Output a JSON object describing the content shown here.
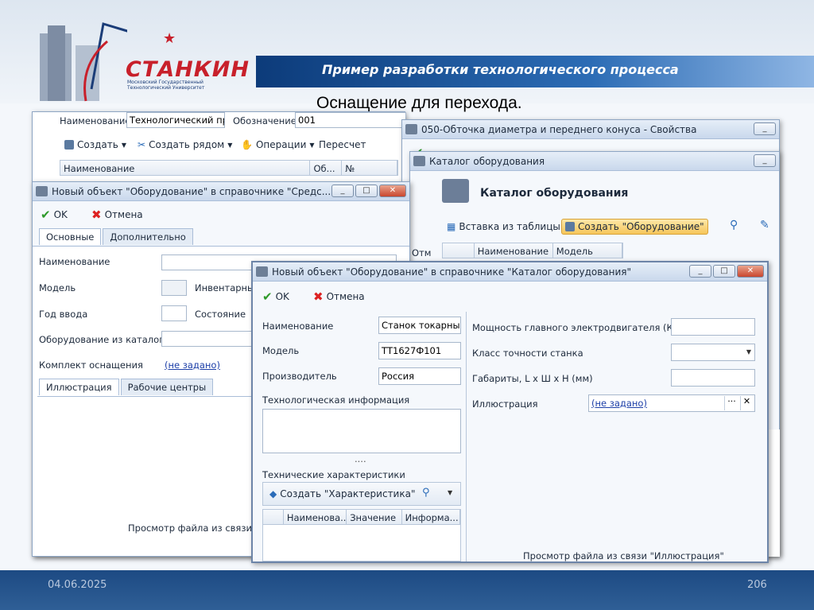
{
  "slide": {
    "title": "Пример разработки технологического процесса",
    "subtitle": "Оснащение для перехода.",
    "date": "04.06.2025",
    "page": "206"
  },
  "logo": {
    "name": "СТАНКИН",
    "subtitle": "Московский Государственный Технологический Университет"
  },
  "colors": {
    "header_bar": "#1b4f93",
    "footer": "#244f86",
    "logo_red": "#c8202b"
  },
  "back_window": {
    "name_label": "Наименование",
    "name_value": "Технологический про",
    "designation_label": "Обозначение",
    "designation_value": "001",
    "toolbar": {
      "create": "Создать",
      "create_near": "Создать рядом",
      "operations": "Операции",
      "recalc": "Пересчет"
    },
    "columns": [
      "Наименование",
      "Об...",
      "№"
    ]
  },
  "props_window": {
    "title": "050-Обточка диаметра и переднего конуса - Свойства",
    "no_label": "№"
  },
  "catalog_window": {
    "title": "Каталог оборудования",
    "heading": "Каталог оборудования",
    "insert_from_table": "Вставка из таблицы",
    "create_btn": "Создать \"Оборудование\"",
    "columns": [
      "Наименование",
      "Модель"
    ],
    "side_labels": [
      "Отм"
    ]
  },
  "left_dialog": {
    "title": "Новый объект \"Оборудование\" в справочнике \"Средс...",
    "ok": "OK",
    "cancel": "Отмена",
    "tabs": [
      "Основные",
      "Дополнительно"
    ],
    "fields": {
      "name": "Наименование",
      "model": "Модель",
      "inventory": "Инвентарный",
      "year": "Год ввода",
      "state": "Состояние",
      "from_catalog": "Оборудование из каталога",
      "kit": "Комплект оснащения",
      "kit_value": "(не задано)"
    },
    "bottom_tabs": [
      "Иллюстрация",
      "Рабочие центры"
    ],
    "preview": "Просмотр файла из связи \"Илл"
  },
  "front_dialog": {
    "title": "Новый объект \"Оборудование\" в справочнике \"Каталог оборудования\"",
    "ok": "OK",
    "cancel": "Отмена",
    "left": {
      "name_label": "Наименование",
      "name_value": "Станок токарный",
      "model_label": "Модель",
      "model_value": "ТТ1627Ф101",
      "maker_label": "Производитель",
      "maker_value": "Россия",
      "techinfo_label": "Технологическая информация",
      "dots": "....",
      "chars_label": "Технические характеристики",
      "create_char": "Создать \"Характеристика\"",
      "columns": [
        "Наименова...",
        "Значение",
        "Информа..."
      ]
    },
    "right": {
      "power_label": "Мощность главного электродвигателя (Квт)",
      "class_label": "Класс точности станка",
      "dims_label": "Габариты, L x Ш x H (мм)",
      "illus_label": "Иллюстрация",
      "illus_value": "(не задано)",
      "preview": "Просмотр файла из связи \"Иллюстрация\""
    }
  }
}
